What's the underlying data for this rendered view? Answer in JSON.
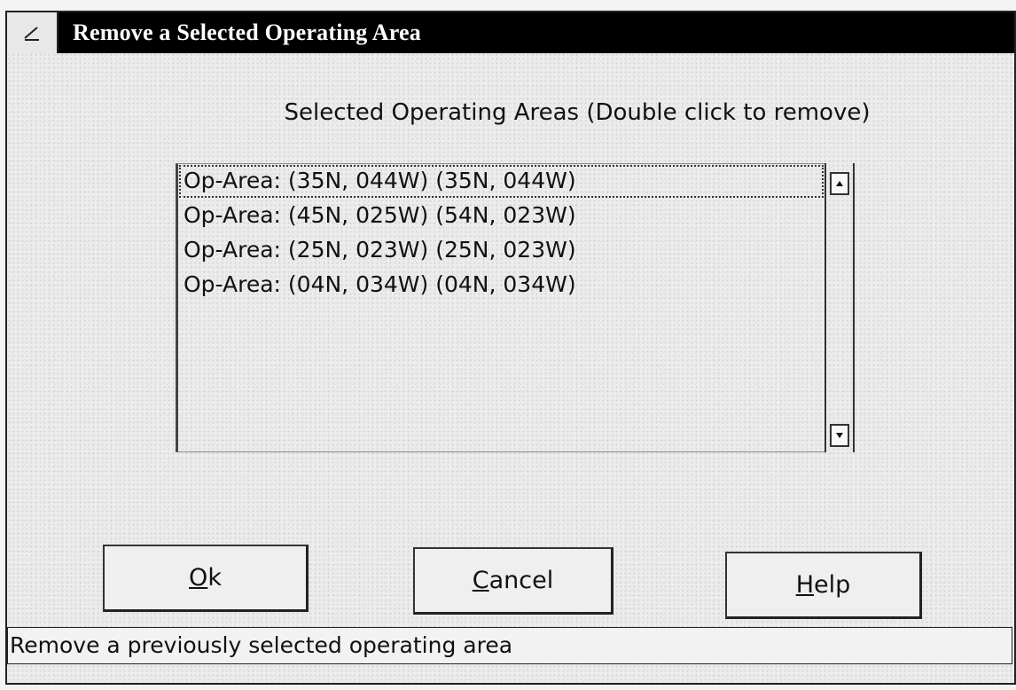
{
  "window": {
    "title": "Remove a Selected Operating Area",
    "system_menu_icon": "system-menu-icon"
  },
  "list": {
    "heading": "Selected Operating Areas (Double click to remove)",
    "items": [
      "Op-Area: (35N, 044W) (35N, 044W)",
      "Op-Area: (45N, 025W) (54N, 023W)",
      "Op-Area: (25N, 023W) (25N, 023W)",
      "Op-Area: (04N, 034W) (04N, 034W)"
    ],
    "scroll_up_icon": "arrow-up-icon",
    "scroll_down_icon": "arrow-down-icon"
  },
  "buttons": {
    "ok": {
      "mnemonic": "O",
      "rest": "k"
    },
    "cancel": {
      "mnemonic": "C",
      "rest": "ancel"
    },
    "help": {
      "mnemonic": "H",
      "rest": "elp"
    }
  },
  "status": {
    "text": "Remove a previously selected operating area"
  },
  "colors": {
    "title_bar": "#000000",
    "title_text": "#ffffff",
    "dialog_bg": "#ececec"
  }
}
